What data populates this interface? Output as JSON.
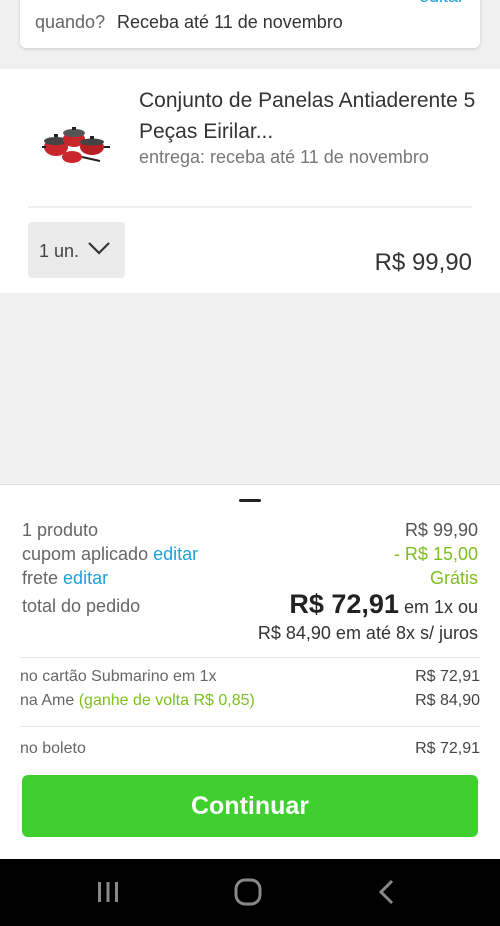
{
  "delivery": {
    "label": "quando?",
    "value": "Receba até 11 de novembro",
    "edit": "editar"
  },
  "product": {
    "title": "Conjunto de Panelas Antiaderente 5 Peças Eirilar...",
    "delivery": "entrega: receba até 11 de novembro",
    "quantity": "1 un.",
    "price": "R$ 99,90"
  },
  "summary": {
    "products_label": "1 produto",
    "products_value": "R$ 99,90",
    "coupon_label": "cupom aplicado",
    "coupon_edit": "editar",
    "coupon_value": "- R$ 15,00",
    "shipping_label": "frete",
    "shipping_edit": "editar",
    "shipping_value": "Grátis",
    "total_label": "total do pedido",
    "total_value": "R$ 72,91",
    "total_suffix": "em 1x ou",
    "installments": "R$ 84,90 em até 8x s/ juros"
  },
  "payment": {
    "card_label": "no cartão Submarino em 1x",
    "card_value": "R$ 72,91",
    "ame_label": "na Ame",
    "ame_cashback": "(ganhe de volta R$ 0,85)",
    "ame_value": "R$ 84,90",
    "boleto_label": "no boleto",
    "boleto_value": "R$ 72,91"
  },
  "continue_label": "Continuar",
  "colors": {
    "accent_blue": "#1fa1d8",
    "accent_green": "#7cbf1f",
    "button_green": "#3fcf2e"
  }
}
